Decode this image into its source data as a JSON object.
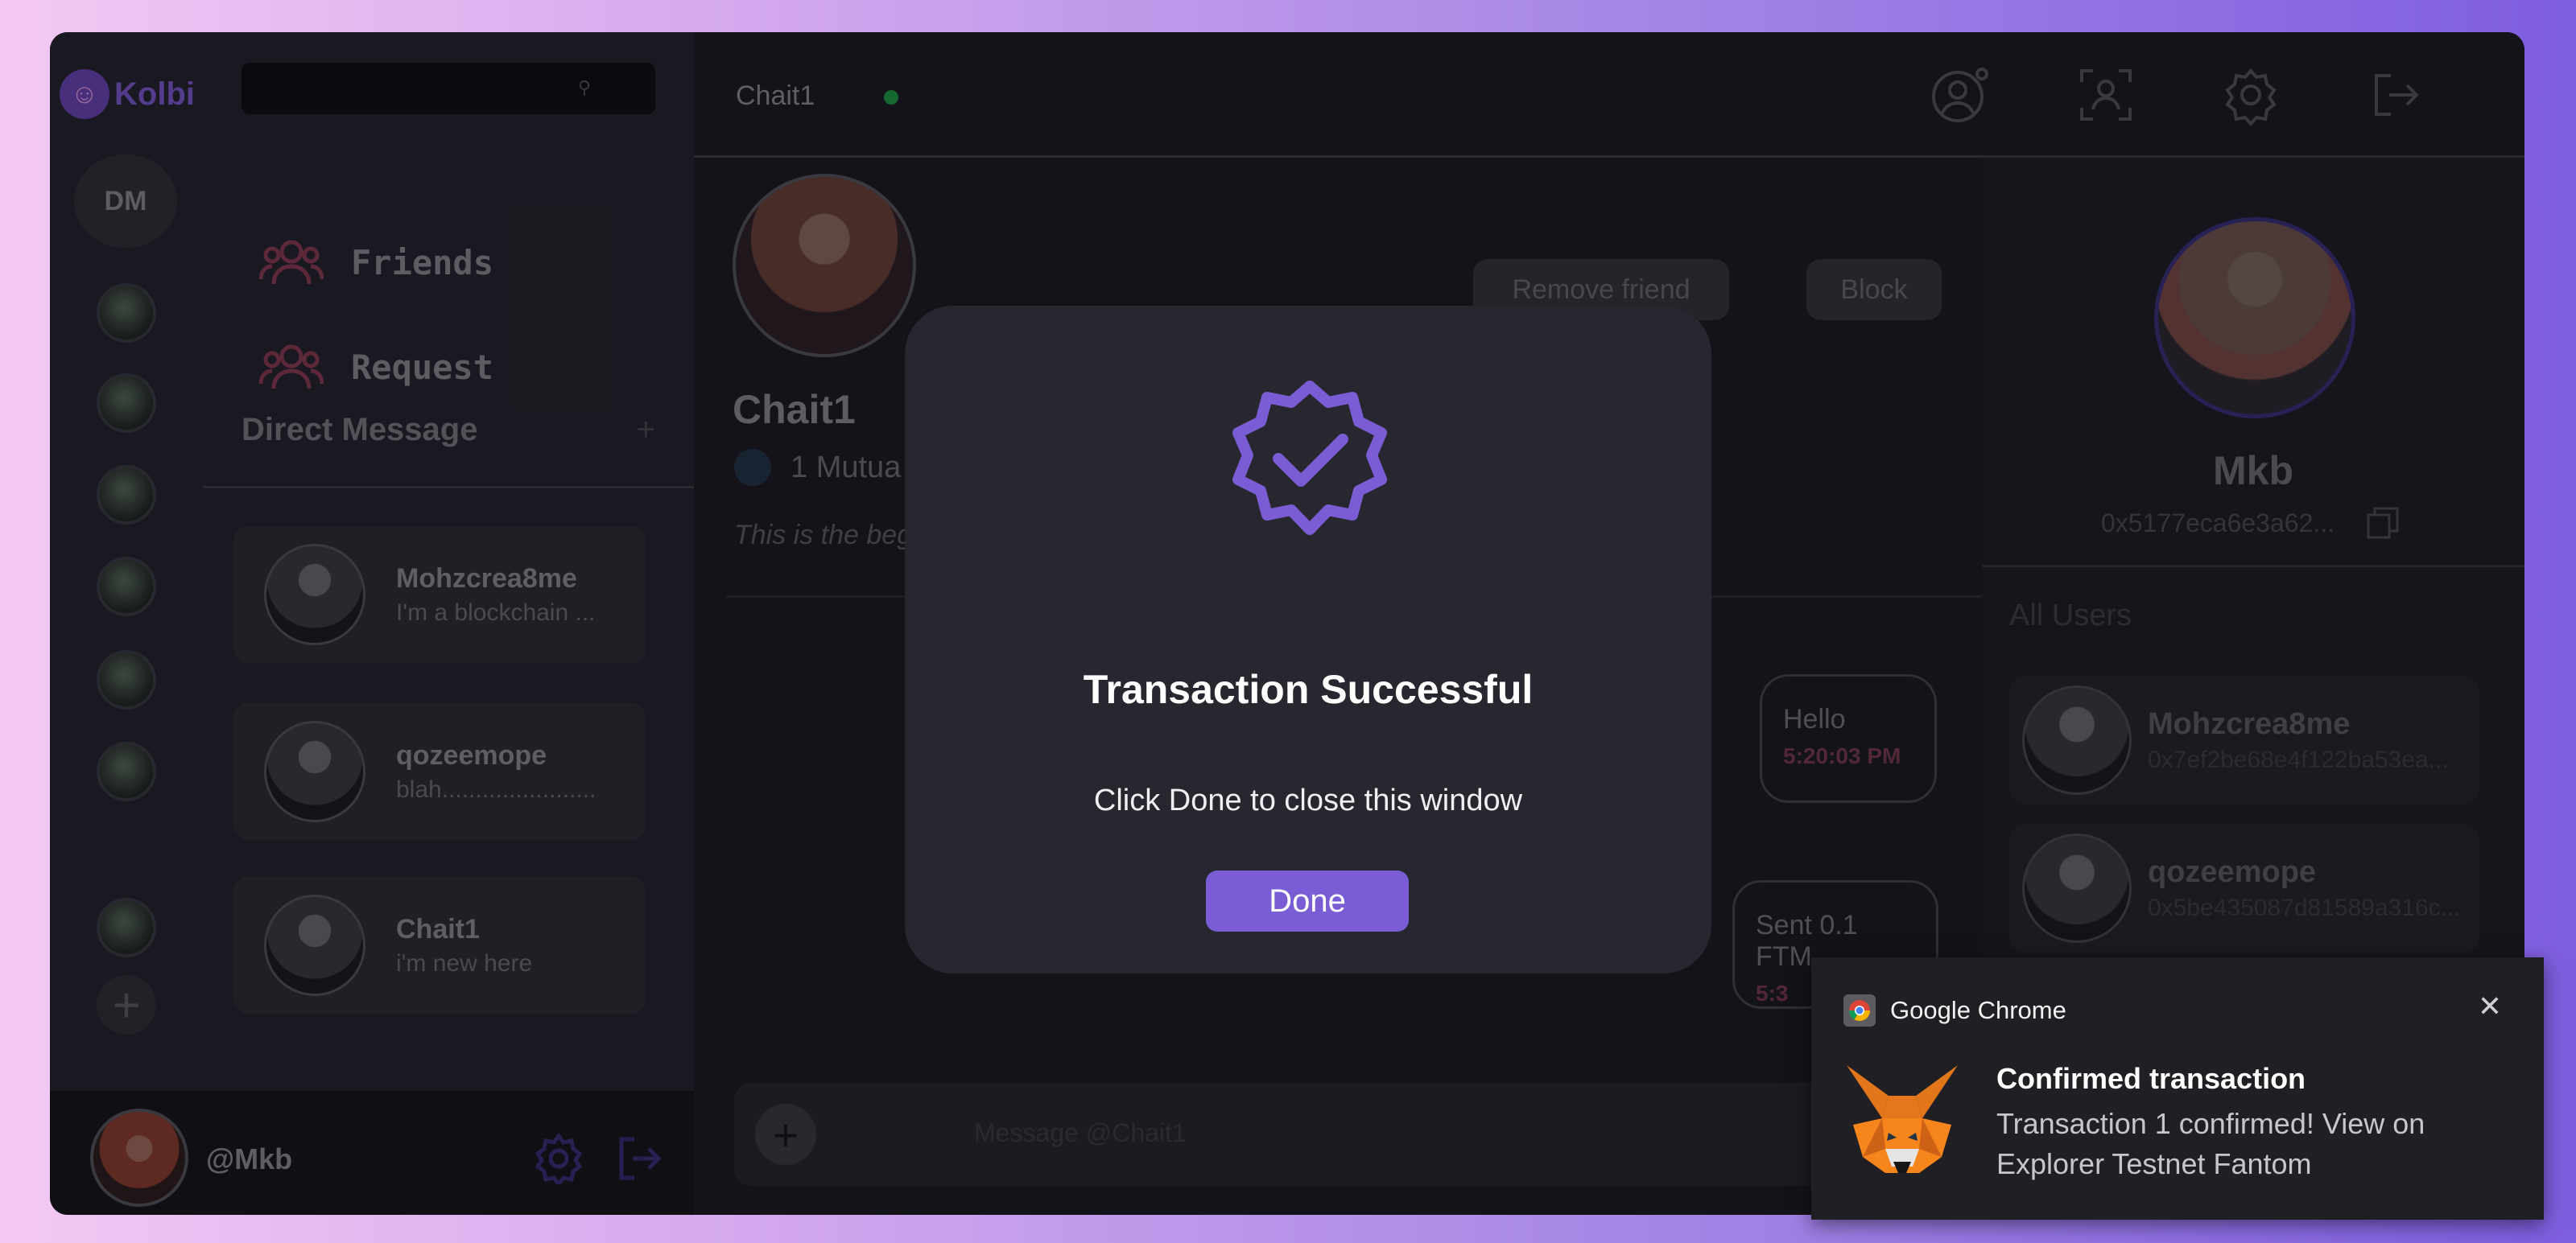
{
  "rail": {
    "logo_text": "Kolbi",
    "dm_label": "DM",
    "add_symbol": "+"
  },
  "sidebar": {
    "search_placeholder": "",
    "nav": [
      {
        "label": "Friends",
        "icon": "friends-icon"
      },
      {
        "label": "Request",
        "icon": "request-icon"
      }
    ],
    "dm_header": "Direct Message",
    "dm_add": "+",
    "conversations": [
      {
        "name": "Mohzcrea8me",
        "preview": "I'm a blockchain ..."
      },
      {
        "name": "qozeemope",
        "preview": "blah......................."
      },
      {
        "name": "Chait1",
        "preview": "i'm new here"
      }
    ]
  },
  "userbar": {
    "username": "@Mkb"
  },
  "chat": {
    "channel": "Chait1",
    "profile_name": "Chait1",
    "mutual": "1 Mutua",
    "beginning_text": "This is the begi",
    "remove_friend": "Remove friend",
    "block": "Block",
    "messages": [
      {
        "text": "Hello",
        "time": "5:20:03 PM"
      },
      {
        "text": "Sent 0.1 FTM",
        "time": "5:3"
      }
    ],
    "composer_placeholder": "Message @Chait1",
    "composer_plus": "+"
  },
  "right_panel": {
    "name": "Mkb",
    "address": "0x5177eca6e3a62...",
    "all_users_label": "All Users",
    "users": [
      {
        "name": "Mohzcrea8me",
        "address": "0x7ef2be68e4f122ba53ea..."
      },
      {
        "name": "qozeemope",
        "address": "0x5be435087d81589a316c..."
      }
    ]
  },
  "modal": {
    "title": "Transaction Successful",
    "subtitle": "Click Done to close this window",
    "button": "Done",
    "icon": "verified-badge-icon",
    "accent": "#7a5dd5"
  },
  "notification": {
    "app": "Google Chrome",
    "title": "Confirmed transaction",
    "body": "Transaction 1 confirmed! View on Explorer Testnet Fantom",
    "close": "✕",
    "icon": "metamask-fox-icon"
  }
}
